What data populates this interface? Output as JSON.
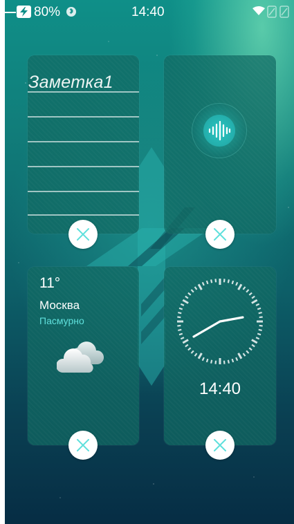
{
  "status_bar": {
    "battery_percent": "80%",
    "time": "14:40",
    "icons": [
      "charging-icon",
      "bluetooth-icon",
      "wifi-icon",
      "sim1-signal-icon",
      "sim2-signal-icon"
    ]
  },
  "widgets": {
    "note": {
      "title": "Заметка1",
      "icon": "note-lines"
    },
    "voice": {
      "icon": "voice-wave-icon"
    },
    "weather": {
      "temperature": "11°",
      "city": "Москва",
      "condition": "Пасмурно",
      "icon": "cloud-icon"
    },
    "clock": {
      "time": "14:40",
      "icon": "analog-clock-icon"
    }
  },
  "remove_button_icon": "close-x-icon",
  "colors": {
    "accent_teal": "#5fe0dc",
    "card_background": "#10695f",
    "remove_button_icon": "#5fe0dc"
  }
}
